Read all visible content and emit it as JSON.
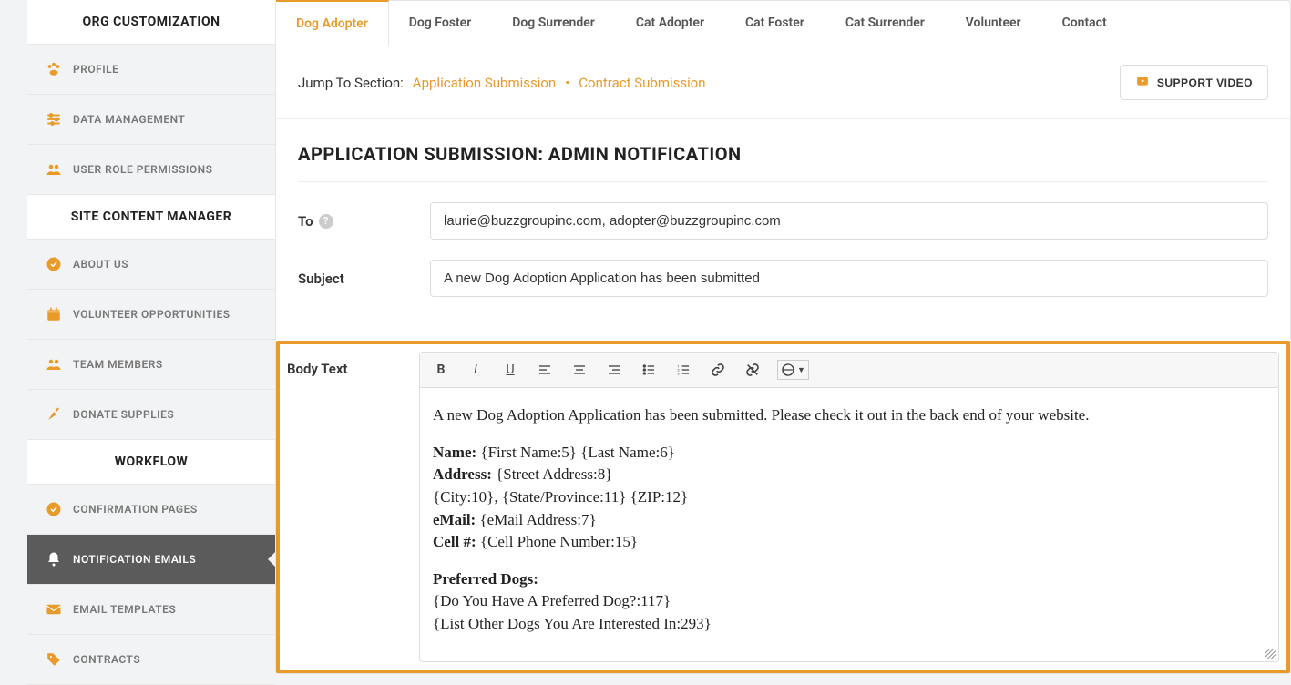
{
  "sidebar": {
    "section1_title": "ORG CUSTOMIZATION",
    "items1": [
      {
        "label": "PROFILE",
        "icon": "paw"
      },
      {
        "label": "DATA MANAGEMENT",
        "icon": "sliders"
      },
      {
        "label": "USER ROLE PERMISSIONS",
        "icon": "users"
      }
    ],
    "section2_title": "SITE CONTENT MANAGER",
    "items2": [
      {
        "label": "ABOUT US",
        "icon": "check-circle"
      },
      {
        "label": "VOLUNTEER OPPORTUNITIES",
        "icon": "calendar"
      },
      {
        "label": "TEAM MEMBERS",
        "icon": "users"
      },
      {
        "label": "DONATE SUPPLIES",
        "icon": "carrot"
      }
    ],
    "section3_title": "WORKFLOW",
    "items3": [
      {
        "label": "CONFIRMATION PAGES",
        "icon": "check-circle"
      },
      {
        "label": "NOTIFICATION EMAILS",
        "icon": "bell",
        "active": true
      },
      {
        "label": "EMAIL TEMPLATES",
        "icon": "envelope"
      },
      {
        "label": "CONTRACTS",
        "icon": "tag"
      }
    ]
  },
  "tabs": [
    {
      "label": "Dog Adopter",
      "active": true
    },
    {
      "label": "Dog Foster"
    },
    {
      "label": "Dog Surrender"
    },
    {
      "label": "Cat Adopter"
    },
    {
      "label": "Cat Foster"
    },
    {
      "label": "Cat Surrender"
    },
    {
      "label": "Volunteer"
    },
    {
      "label": "Contact"
    }
  ],
  "jump": {
    "label": "Jump To Section:",
    "links": [
      "Application Submission",
      "Contract Submission"
    ]
  },
  "support_btn": "SUPPORT VIDEO",
  "section_title": "APPLICATION SUBMISSION: ADMIN NOTIFICATION",
  "form": {
    "to_label": "To",
    "to_value": "laurie@buzzgroupinc.com, adopter@buzzgroupinc.com",
    "subject_label": "Subject",
    "subject_value": "A new Dog Adoption Application has been submitted",
    "body_label": "Body Text"
  },
  "body": {
    "intro": "A new Dog Adoption Application has been submitted. Please check it out in the back end of your website.",
    "name_l": "Name:",
    "name_v": " {First Name:5} {Last Name:6}",
    "addr_l": "Address:",
    "addr_v": " {Street Address:8}",
    "city_v": "{City:10}, {State/Province:11} {ZIP:12}",
    "email_l": "eMail:",
    "email_v": " {eMail Address:7}",
    "cell_l": "Cell #:",
    "cell_v": " {Cell Phone Number:15}",
    "pref_l": "Preferred Dogs:",
    "pref1": "{Do You Have A Preferred Dog?:117}",
    "pref2": "{List Other Dogs You Are Interested In:293}"
  }
}
